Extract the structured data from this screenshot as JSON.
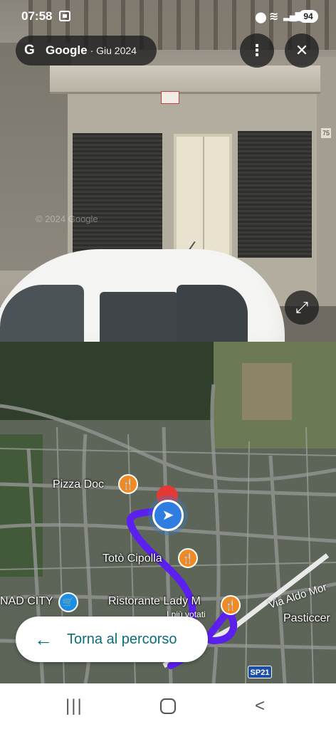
{
  "status_bar": {
    "time": "07:58",
    "battery": "94"
  },
  "header": {
    "brand": "Google",
    "date": "· Giu 2024"
  },
  "buttons": {
    "more": "⋮",
    "close": "✕",
    "expand": "⤢"
  },
  "street_view": {
    "watermark": "© 2024 Google",
    "house_number": "75"
  },
  "map": {
    "pois": [
      {
        "name": "Pizza Doc"
      },
      {
        "name": "Totò Cipolla"
      },
      {
        "name": "Ristorante Lady M",
        "sub": "I più votati"
      },
      {
        "name": "NAD CITY"
      },
      {
        "name": "Pasticcer"
      }
    ],
    "road_name": "Via Aldo Mor",
    "road_shield": "SP21",
    "back_button_label": "Torna al percorso",
    "colors": {
      "route": "#5b1ff0",
      "food_pin": "#f08a24",
      "shop_pin": "#1a8fe3",
      "location": "#2f7de1"
    }
  },
  "navbar": {
    "recent": "|||",
    "back": "<"
  }
}
